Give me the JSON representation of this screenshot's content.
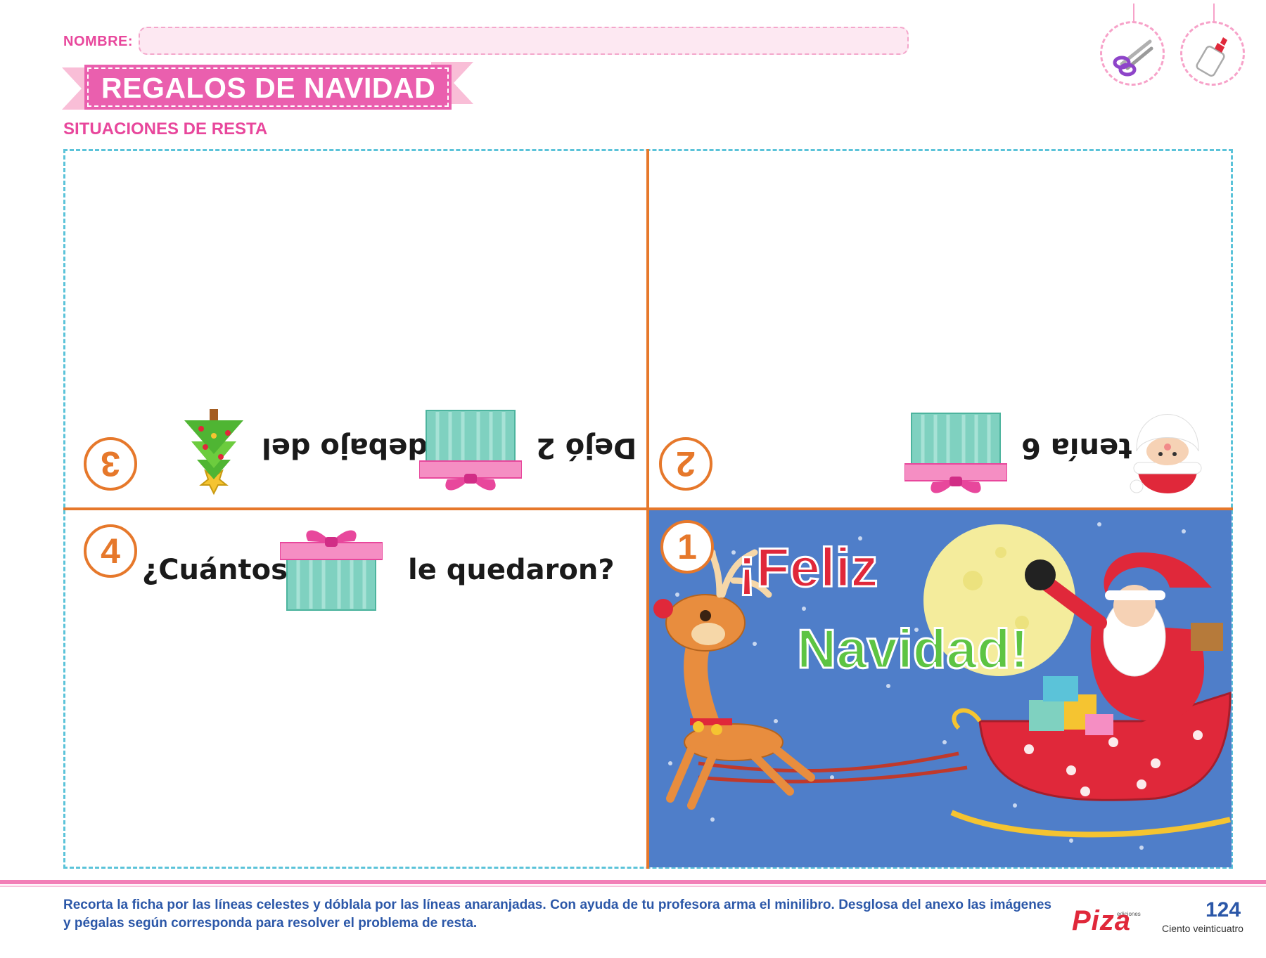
{
  "header": {
    "name_label": "NOMBRE:",
    "title": "REGALOS DE NAVIDAD",
    "subtitle": "SITUACIONES DE RESTA",
    "tools": [
      "scissors-icon",
      "glue-icon"
    ]
  },
  "panels": {
    "p1": {
      "number": "1",
      "greeting_line1": "¡Feliz",
      "greeting_line2": "Navidad!"
    },
    "p2": {
      "number": "2",
      "text": "tenía 6"
    },
    "p3": {
      "number": "3",
      "text_a": "Dejó 2",
      "text_b": "debajo del"
    },
    "p4": {
      "number": "4",
      "text_a": "¿Cuántos",
      "text_b": "le quedaron?"
    }
  },
  "footer": {
    "instructions": "Recorta la ficha por las líneas celestes y dóblala por las líneas anaranjadas. Con ayuda de tu profesora arma el minilibro. Desglosa del anexo las imágenes y pégalas según corresponda para resolver el problema de resta.",
    "brand_small": "ediciones",
    "brand": "Piza",
    "page_number": "124",
    "page_words": "Ciento veinticuatro"
  },
  "colors": {
    "pink": "#e8479c",
    "orange": "#e6782b",
    "cyan": "#5bc3d9",
    "blue": "#2b57a8",
    "sky": "#4f7ec9",
    "red": "#e0283a",
    "green": "#5dc443"
  }
}
